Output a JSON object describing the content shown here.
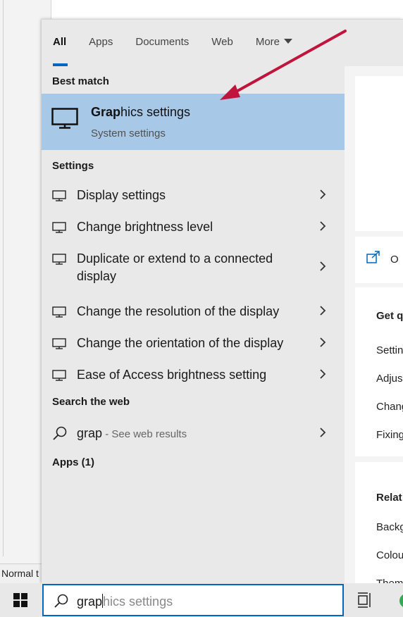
{
  "background_app": {
    "status_text": "Normal t"
  },
  "tabs": [
    {
      "label": "All",
      "active": true
    },
    {
      "label": "Apps",
      "active": false
    },
    {
      "label": "Documents",
      "active": false
    },
    {
      "label": "Web",
      "active": false
    },
    {
      "label": "More",
      "active": false
    }
  ],
  "best_match": {
    "section_title": "Best match",
    "title_bold": "Grap",
    "title_rest": "hics settings",
    "subtitle": "System settings",
    "icon": "monitor-icon"
  },
  "settings": {
    "section_title": "Settings",
    "items": [
      {
        "label": "Display settings"
      },
      {
        "label": "Change brightness level"
      },
      {
        "label": "Duplicate or extend to a connected display"
      },
      {
        "label": "Change the resolution of the display"
      },
      {
        "label": "Change the orientation of the display"
      },
      {
        "label": "Ease of Access brightness setting"
      }
    ]
  },
  "web": {
    "section_title": "Search the web",
    "query": "grap",
    "hint": " - See web results"
  },
  "apps": {
    "section_title": "Apps (1)"
  },
  "preview": {
    "open_label": "O",
    "quick_title": "Get q",
    "quick_items": [
      "Settin",
      "Adjus",
      "Chang",
      "Fixing"
    ],
    "related_title": "Relat",
    "related_items": [
      "Backg",
      "Colou",
      "Them"
    ]
  },
  "search": {
    "typed": "grap",
    "suggestion": "hics settings"
  },
  "colors": {
    "accent": "#0067c0",
    "selected_bg": "#a8c8e8",
    "annotation_arrow": "#c0143c"
  }
}
